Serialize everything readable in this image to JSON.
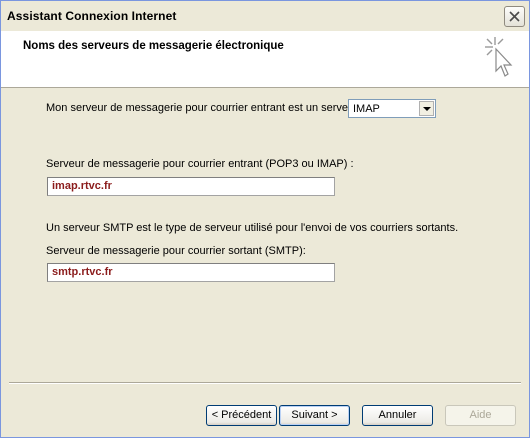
{
  "window": {
    "title": "Assistant Connexion Internet"
  },
  "header": {
    "title": "Noms des serveurs de messagerie électronique"
  },
  "form": {
    "server_type_label": "Mon serveur de messagerie pour courrier entrant est un serveur",
    "server_type_value": "IMAP",
    "incoming_label": "Serveur de messagerie pour courrier entrant (POP3 ou IMAP) :",
    "incoming_value": "imap.rtvc.fr",
    "smtp_info": "Un serveur SMTP est le type de serveur utilisé pour l'envoi de vos courriers sortants.",
    "outgoing_label": "Serveur de messagerie pour courrier sortant (SMTP):",
    "outgoing_value": "smtp.rtvc.fr"
  },
  "buttons": {
    "previous": "< Précédent",
    "next": "Suivant >",
    "cancel": "Annuler",
    "help": "Aide"
  }
}
